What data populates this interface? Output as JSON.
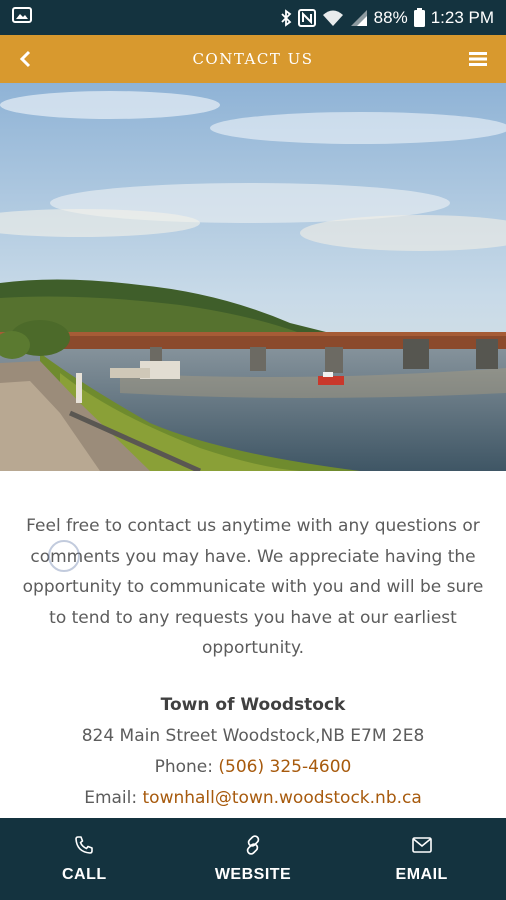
{
  "status_bar": {
    "battery": "88%",
    "time": "1:23 PM",
    "icons": [
      "image-icon",
      "bluetooth-icon",
      "nfc-icon",
      "wifi-icon",
      "signal-icon",
      "battery-icon"
    ]
  },
  "header": {
    "title": "CONTACT US",
    "back_icon": "chevron-left-icon",
    "menu_icon": "hamburger-menu-icon",
    "color": "#d8992e"
  },
  "hero": {
    "description_icon": "photo"
  },
  "content": {
    "intro": "Feel free to contact us anytime with any questions or comments you may have. We appreciate having the opportunity to communicate with you and will be sure to tend to any requests you have at our earliest opportunity.",
    "org_name": "Town of Woodstock",
    "address": "824 Main Street Woodstock,NB E7M 2E8",
    "phone_label": "Phone: ",
    "phone": "(506) 325-4600",
    "email_label": "Email: ",
    "email": "townhall@town.woodstock.nb.ca",
    "link_color": "#a75a0d"
  },
  "bottom_nav": {
    "items": [
      {
        "label": "CALL",
        "icon": "phone-icon"
      },
      {
        "label": "WEBSITE",
        "icon": "link-icon"
      },
      {
        "label": "EMAIL",
        "icon": "mail-icon"
      }
    ],
    "background": "#14333f"
  }
}
